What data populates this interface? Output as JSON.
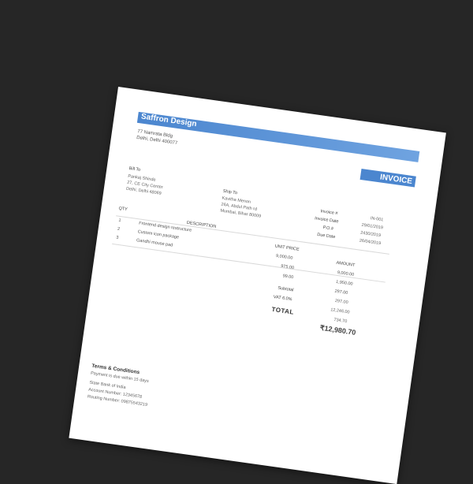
{
  "company": {
    "name": "Saffron Design",
    "address_lines": [
      "77 Namrata Bldg",
      "Delhi, Delhi 400077"
    ]
  },
  "doc_title": "INVOICE",
  "bill_to": {
    "heading": "Bill To",
    "lines": [
      "Pankaj Shinde",
      "27, CE City Center",
      "Delhi, Delhi 48069"
    ]
  },
  "ship_to": {
    "heading": "Ship To",
    "lines": [
      "Kavitha Menon",
      "26A, Abdul Path rd",
      "Mumbai, Bihar 80009"
    ]
  },
  "meta": {
    "labels": [
      "Invoice #",
      "Invoice Date",
      "P.O.#",
      "Due Date"
    ],
    "values": [
      "IN-001",
      "29/01/2019",
      "2430/2019",
      "26/04/2019"
    ]
  },
  "table": {
    "headers": {
      "qty": "QTY",
      "description": "DESCRIPTION",
      "unit_price": "UNIT PRICE",
      "amount": "AMOUNT"
    },
    "rows": [
      {
        "qty": "1",
        "description": "Frontend design restructure",
        "unit_price": "9,000.00",
        "amount": "9,000.00"
      },
      {
        "qty": "2",
        "description": "Custom icon package",
        "unit_price": "975.00",
        "amount": "1,950.00"
      },
      {
        "qty": "3",
        "description": "Gandhi mouse pad",
        "unit_price": "99.00",
        "amount": "297.00"
      }
    ]
  },
  "summary": {
    "subtotal_label": "Subtotal",
    "subtotal_value": "297.00",
    "vat_label": "VAT 6.0%",
    "vat_value": "734.70",
    "subtotal_value_2": "12,246.00",
    "total_label": "TOTAL",
    "total_value": "₹12,980.70"
  },
  "footer": {
    "title": "Terms & Conditions",
    "lines": [
      "Payment is due within 15 days",
      "State Bank of India",
      "Account Number: 12345678",
      "Routing Number: 09875543219"
    ]
  }
}
